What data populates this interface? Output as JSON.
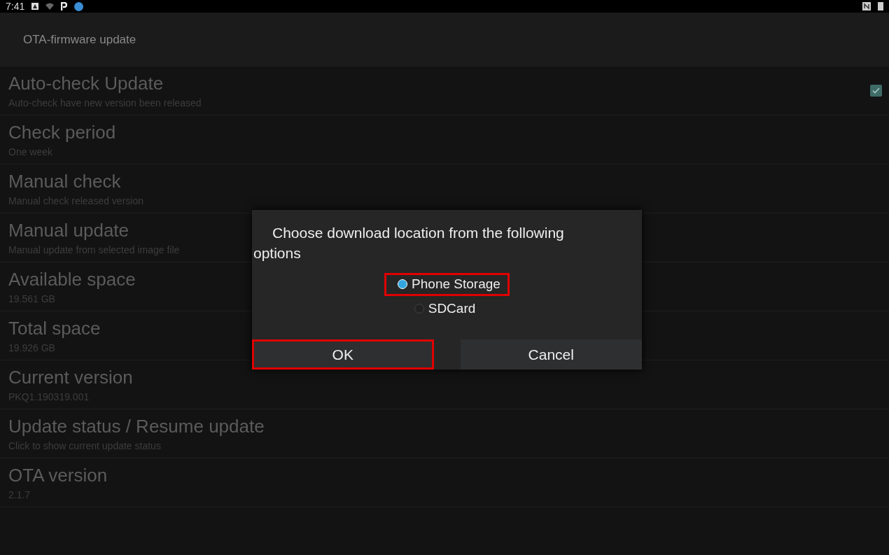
{
  "status_bar": {
    "time": "7:41"
  },
  "app_bar": {
    "title": "OTA-firmware update"
  },
  "settings": [
    {
      "kind": "checkbox",
      "title": "Auto-check Update",
      "summary": "Auto-check have new version been released",
      "checked": true
    },
    {
      "kind": "plain",
      "title": "Check period",
      "summary": "One week"
    },
    {
      "kind": "plain",
      "title": "Manual check",
      "summary": "Manual check released version"
    },
    {
      "kind": "plain",
      "title": "Manual update",
      "summary": "Manual update from selected image file"
    },
    {
      "kind": "plain",
      "title": "Available space",
      "summary": "19.561 GB"
    },
    {
      "kind": "plain",
      "title": "Total space",
      "summary": "19.926 GB"
    },
    {
      "kind": "plain",
      "title": "Current version",
      "summary": "PKQ1.190319.001"
    },
    {
      "kind": "plain",
      "title": "Update status / Resume update",
      "summary": "Click to show current update status"
    },
    {
      "kind": "plain",
      "title": "OTA version",
      "summary": "2.1.7"
    }
  ],
  "dialog": {
    "message": "Choose download location from the following options",
    "options": [
      {
        "label": "Phone Storage",
        "selected": true,
        "highlighted": true
      },
      {
        "label": "SDCard",
        "selected": false,
        "highlighted": false
      }
    ],
    "buttons": [
      {
        "label": "OK",
        "highlighted": true
      },
      {
        "label": "Cancel",
        "highlighted": false
      }
    ]
  }
}
